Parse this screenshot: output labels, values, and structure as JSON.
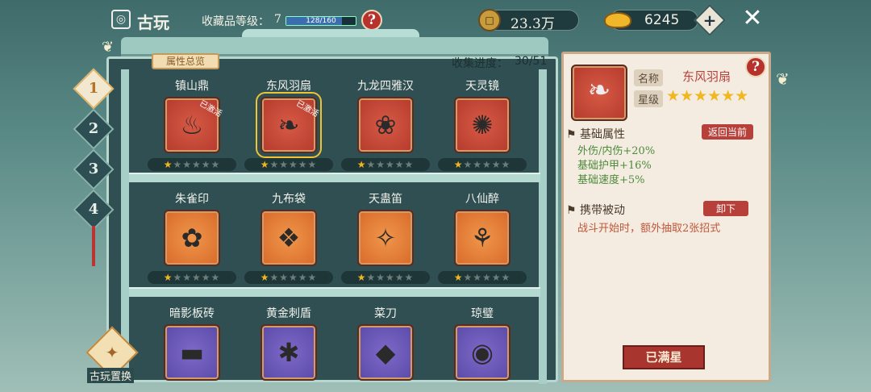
{
  "header": {
    "title": "古玩",
    "collect_level_label": "收藏品等级：",
    "collect_level": "7",
    "exp_text": "128/160",
    "exp_fraction": 0.8,
    "currency1": "23.3万",
    "currency2": "6245"
  },
  "shelf": {
    "tab_overview": "属性总览",
    "progress_label": "收集进度：",
    "progress": "30/51",
    "tabs": [
      "1",
      "2",
      "3",
      "4"
    ],
    "swap_label": "古玩置换"
  },
  "items": [
    {
      "name": "镇山鼎",
      "badge": "已激活",
      "stars": 1
    },
    {
      "name": "东风羽扇",
      "badge": "已激活",
      "stars": 1
    },
    {
      "name": "九龙四雅汉",
      "badge": "",
      "stars": 1
    },
    {
      "name": "天灵镜",
      "badge": "",
      "stars": 1
    },
    {
      "name": "朱雀印",
      "badge": "",
      "stars": 1
    },
    {
      "name": "九布袋",
      "badge": "",
      "stars": 1
    },
    {
      "name": "天蛊笛",
      "badge": "",
      "stars": 1
    },
    {
      "name": "八仙醉",
      "badge": "",
      "stars": 1
    },
    {
      "name": "暗影板砖",
      "badge": "",
      "stars": 0
    },
    {
      "name": "黄金刺盾",
      "badge": "",
      "stars": 0
    },
    {
      "name": "菜刀",
      "badge": "",
      "stars": 0
    },
    {
      "name": "琼璧",
      "badge": "",
      "stars": 0
    }
  ],
  "detail": {
    "name_label": "名称",
    "name": "东风羽扇",
    "star_label": "星级",
    "stars": "★★★★★★",
    "base_title": "基础属性",
    "return_btn": "返回当前",
    "attrs": [
      "外伤/内伤+20%",
      "基础护甲+16%",
      "基础速度+5%"
    ],
    "passive_title": "携带被动",
    "unload_btn": "卸下",
    "passive_desc": "战斗开始时，额外抽取2张招式",
    "max_btn": "已满星"
  }
}
